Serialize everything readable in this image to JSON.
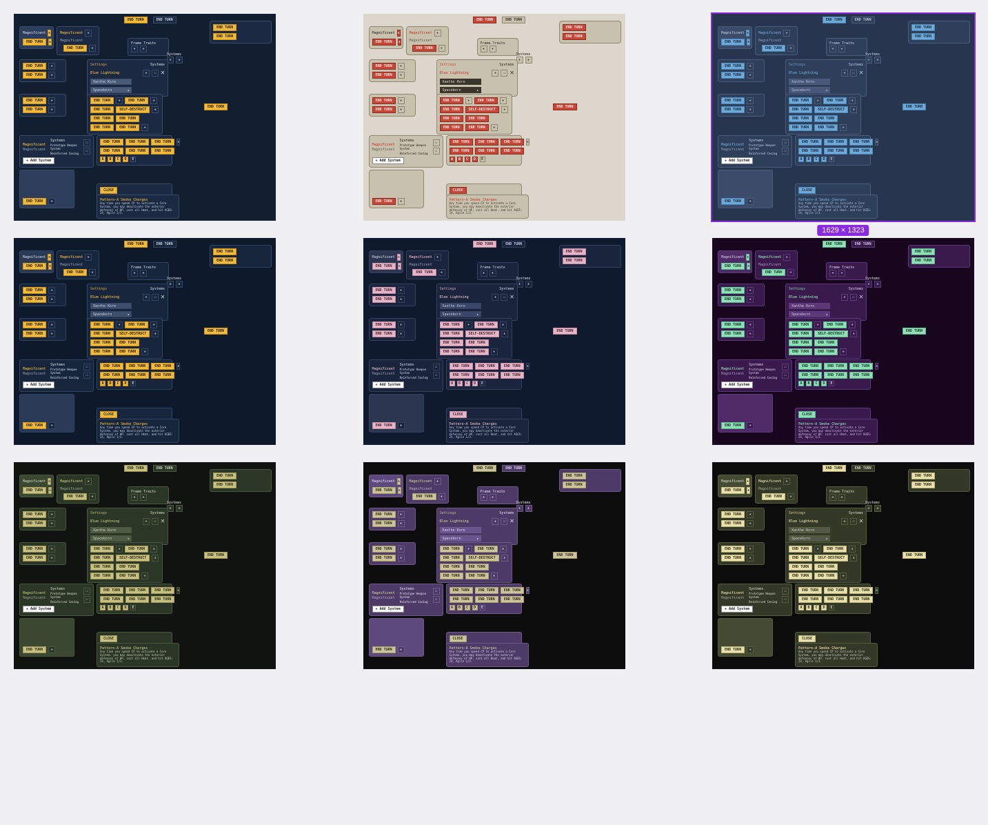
{
  "selection_dim": "1629 × 1323",
  "text": {
    "end_turn": "END TURN",
    "magnificent": "Magnificent",
    "frame_traits": "Frame Traits",
    "systems": "Systems",
    "settings": "Settings",
    "blue_lightning": "Blue Lightning",
    "xanthe_kore": "Xanthe Kore",
    "spaceborn": "Spaceborn",
    "self_destruct": "SELF-DESTRUCT",
    "add_system": "+ Add System",
    "close": "CLOSE",
    "pattern": "Pattern-A Smoke Charges",
    "desc": "Any time you spend CP to activate a Core System, you may deactivate the exterior defenses of HP, cost all Heat, and hit AGES: 24, Agile 1/3.",
    "reinforced": "Reinforced Casing",
    "prototype": "Prototype Weapon System"
  },
  "themes": [
    {
      "cls": "t1"
    },
    {
      "cls": "t2"
    },
    {
      "cls": "t3",
      "selected": true
    },
    {
      "cls": "t4"
    },
    {
      "cls": "t5"
    },
    {
      "cls": "t6"
    },
    {
      "cls": "t7"
    },
    {
      "cls": "t8"
    },
    {
      "cls": "t9"
    }
  ]
}
